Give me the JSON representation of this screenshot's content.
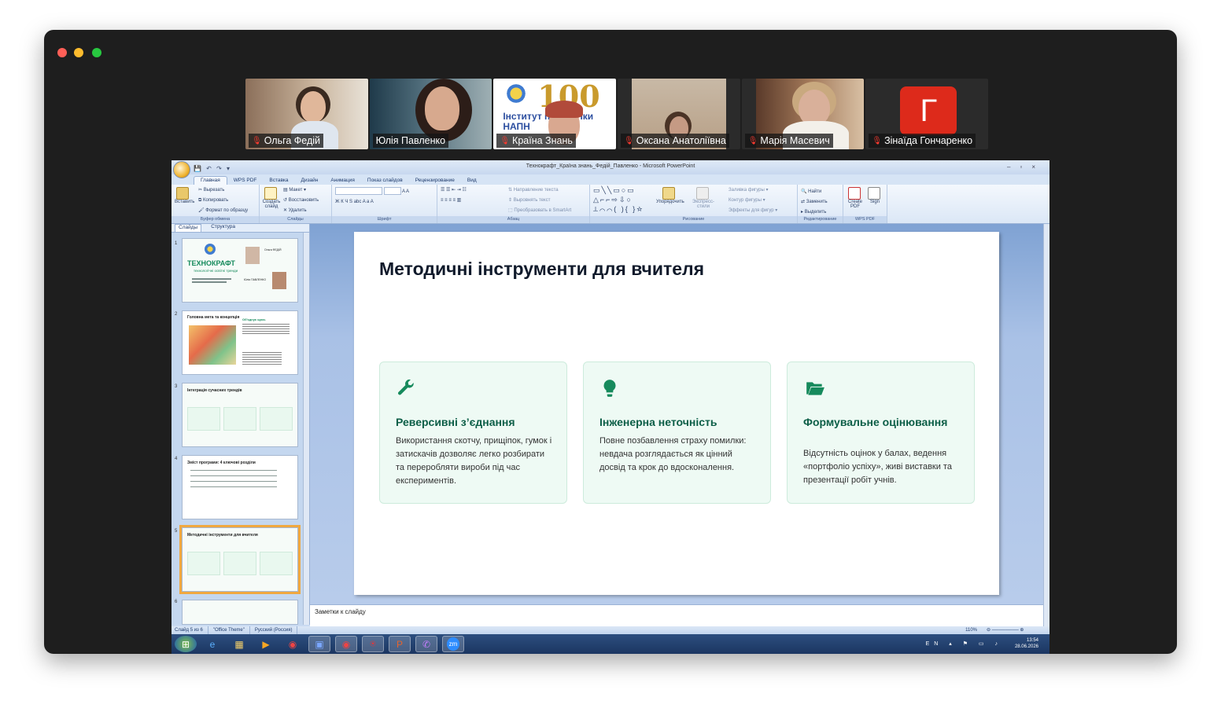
{
  "participants": [
    {
      "name": "Ольга Федій",
      "active": false
    },
    {
      "name": "Юлія Павленко",
      "active": true
    },
    {
      "name": "Країна Знань",
      "active": false,
      "bg_text": "100",
      "bg_sub": "Інститут педагогіки НАПН"
    },
    {
      "name": "Оксана Анатоліївна",
      "active": false
    },
    {
      "name": "Марія Масевич",
      "active": false
    },
    {
      "name": "Зінаїда Гончаренко",
      "active": false,
      "avatar_letter": "Г"
    }
  ],
  "ppt": {
    "window_title": "Технокрафт_Країна знань_Федій_Павленко - Microsoft PowerPoint",
    "tabs": [
      "Главная",
      "WPS PDF",
      "Вставка",
      "Дизайн",
      "Анимация",
      "Показ слайдов",
      "Рецензирование",
      "Вид"
    ],
    "ribbon": {
      "clipboard": {
        "paste": "Вставить",
        "cut": "Вырезать",
        "copy": "Копировать",
        "format": "Формат по образцу",
        "label": "Буфер обмена"
      },
      "slides": {
        "create": "Создать слайд",
        "layout": "Макет",
        "restore": "Восстановить",
        "delete": "Удалить",
        "label": "Слайды"
      },
      "font": {
        "label": "Шрифт"
      },
      "paragraph": {
        "direction": "Направление текста",
        "align": "Выровнять текст",
        "smartart": "Преобразовать в SmartArt",
        "label": "Абзац"
      },
      "drawing": {
        "arrange": "Упорядочить",
        "styles": "Экспресс-стили",
        "fill": "Заливка фигуры",
        "outline": "Контур фигуры",
        "effects": "Эффекты для фигур",
        "label": "Рисование"
      },
      "editing": {
        "find": "Найти",
        "replace": "Заменить",
        "select": "Выделить",
        "label": "Редактирование"
      },
      "wps": {
        "create_pdf": "Create PDF",
        "sign": "Sign",
        "label": "WPS PDF"
      }
    },
    "panel_tabs": [
      "Слайды",
      "Структура"
    ],
    "thumbnails": [
      {
        "num": "1",
        "title": "ТЕХНОКРАФТ",
        "subtitle": "технологічні освітні тренди",
        "person": "Ольга ФЕДІЙ",
        "person2": "Юлія ПАВЛЕНКО"
      },
      {
        "num": "2",
        "title": "Головна мета та концепція",
        "subtitle": "Об'єднує щось"
      },
      {
        "num": "3",
        "title": "Інтеграція сучасних трендів"
      },
      {
        "num": "4",
        "title": "Зміст програми: 4 ключові розділи"
      },
      {
        "num": "5",
        "title": "Методичні інструменти для вчителя"
      },
      {
        "num": "6"
      }
    ],
    "slide": {
      "title": "Методичні інструменти для вчителя",
      "cards": [
        {
          "icon": "wrench-icon",
          "title": "Реверсивні з’єднання",
          "text": "Використання скотчу, прищіпок, гумок і затискачів дозволяє легко розбирати та переробляти вироби під час експериментів."
        },
        {
          "icon": "lightbulb-icon",
          "title": "Інженерна неточність",
          "text": "Повне позбавлення страху помилки: невдача розглядається як цінний досвід та крок до вдосконалення."
        },
        {
          "icon": "folder-open-icon",
          "title": "Формувальне оцінювання",
          "text": "Відсутність оцінок у балах, ведення «портфоліо успіху», живі виставки та презентації робіт учнів."
        }
      ]
    },
    "notes_placeholder": "Заметки к слайду",
    "status": {
      "slide": "Слайд 5 из 6",
      "theme": "\"Office Theme\"",
      "lang": "Русский (Россия)",
      "zoom": "110%"
    },
    "tray": {
      "lang": "EN",
      "time": "13:54",
      "date": "28.06.2026"
    },
    "colors": {
      "accent": "#0c5e47",
      "card_bg": "#eefaf4",
      "active_speaker": "#23c552"
    }
  }
}
